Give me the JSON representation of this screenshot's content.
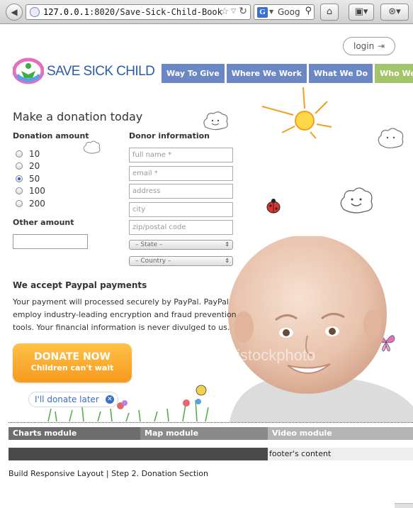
{
  "browser": {
    "url_host": "127.0.0.1",
    "url_rest": ":8020/Save-Sick-Child-Book",
    "search_engine_icon": "G",
    "search_text": "Goog",
    "icons": [
      "back-icon",
      "globe-icon",
      "bookmark-star-icon",
      "reload-icon",
      "search-icon",
      "home-icon",
      "toolbar-icon",
      "addon-icon"
    ]
  },
  "header": {
    "login_label": "login",
    "logo_text": "SAVE SICK CHILD",
    "nav": [
      "Way To Give",
      "Where We Work",
      "What We Do",
      "Who We Are"
    ]
  },
  "donation": {
    "title": "Make a donation today",
    "amount_heading": "Donation amount",
    "amounts": [
      "10",
      "20",
      "50",
      "100",
      "200"
    ],
    "selected_amount": "50",
    "other_heading": "Other amount",
    "other_value": ""
  },
  "donor": {
    "heading": "Donor information",
    "fields": {
      "full_name": "full name *",
      "email": "email *",
      "address": "address",
      "city": "city",
      "zip": "zip/postal code"
    },
    "state_select": "– State –",
    "country_select": "– Country –"
  },
  "paypal": {
    "heading": "We accept Paypal payments",
    "text": "Your payment will processed securely by PayPal. PayPal employ industry-leading encryption and fraud prevention tools. Your financial information is never divulged to us."
  },
  "cta": {
    "donate_main": "DONATE NOW",
    "donate_sub": "Children can't wait",
    "later": "I'll donate later"
  },
  "modules": [
    "Charts module",
    "Map module",
    "Video module"
  ],
  "footer": {
    "content": "footer's content",
    "caption": "Build Responsive Layout | Step 2. Donation Section"
  },
  "watermark": "istockphoto",
  "colors": {
    "nav_blue": "#6b88c4",
    "nav_green": "#a4c46c",
    "donate_orange": "#f79a1c",
    "logo_blue": "#2e5aa8"
  }
}
